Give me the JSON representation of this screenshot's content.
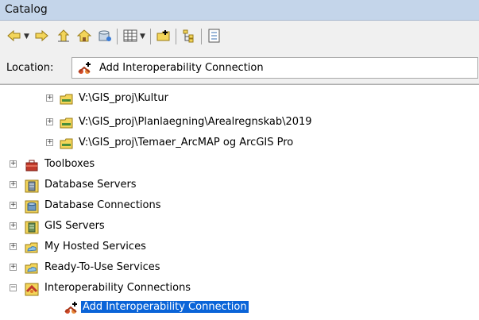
{
  "window": {
    "title": "Catalog"
  },
  "toolbar": {
    "buttons": [
      {
        "name": "back-button",
        "icon": "arrow-left-icon"
      },
      {
        "name": "forward-button",
        "icon": "arrow-right-icon"
      },
      {
        "name": "up-one-level-button",
        "icon": "up-level-icon"
      },
      {
        "name": "home-button",
        "icon": "home-folder-icon"
      },
      {
        "name": "default-gdb-button",
        "icon": "database-icon"
      },
      {
        "name": "views-button",
        "icon": "views-grid-icon"
      },
      {
        "name": "connect-to-folder-button",
        "icon": "connect-folder-icon"
      },
      {
        "name": "toggle-contents-panel-button",
        "icon": "tree-toggle-icon"
      },
      {
        "name": "options-button",
        "icon": "options-list-icon"
      }
    ]
  },
  "location": {
    "label": "Location:",
    "value": "Add Interoperability Connection"
  },
  "tree": {
    "items": [
      {
        "label": "V:\\GIS_proj\\Kultur",
        "icon": "folder-connection-icon",
        "level": 1,
        "expander": "+"
      },
      {
        "label": "V:\\GIS_proj\\Planlaegning\\Arealregnskab\\2019",
        "icon": "folder-connection-icon",
        "level": 1,
        "expander": "+"
      },
      {
        "label": "V:\\GIS_proj\\Temaer_ArcMAP og ArcGIS Pro",
        "icon": "folder-connection-icon",
        "level": 1,
        "expander": "+"
      },
      {
        "label": "Toolboxes",
        "icon": "toolbox-icon",
        "level": 0,
        "expander": "+"
      },
      {
        "label": "Database Servers",
        "icon": "database-server-icon",
        "level": 0,
        "expander": "+"
      },
      {
        "label": "Database Connections",
        "icon": "database-connection-icon",
        "level": 0,
        "expander": "+"
      },
      {
        "label": "GIS Servers",
        "icon": "gis-server-icon",
        "level": 0,
        "expander": "+"
      },
      {
        "label": "My Hosted Services",
        "icon": "hosted-services-icon",
        "level": 0,
        "expander": "+"
      },
      {
        "label": "Ready-To-Use Services",
        "icon": "ready-to-use-services-icon",
        "level": 0,
        "expander": "+"
      },
      {
        "label": "Interoperability Connections",
        "icon": "interoperability-connections-icon",
        "level": 0,
        "expander": "−"
      },
      {
        "label": "Add Interoperability Connection",
        "icon": "add-interop-connection-icon",
        "level": 1,
        "expander": "",
        "selected": true
      }
    ]
  },
  "colors": {
    "titlebar": "#c4d5ea",
    "selection": "#0a64d8",
    "toolbar": "#f0f0f0"
  }
}
